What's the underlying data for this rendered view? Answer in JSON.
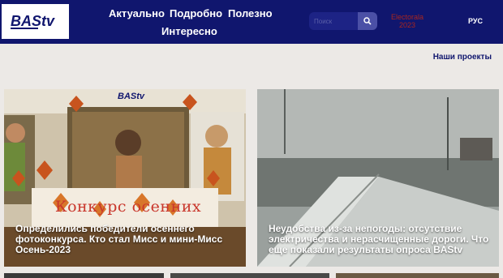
{
  "header": {
    "logo_text": "BAStv",
    "nav": [
      "Актуально",
      "Подробно",
      "Полезно",
      "Интересно"
    ],
    "search_placeholder": "Поиск",
    "electorala": "Electorala 2023",
    "language": "РУС"
  },
  "projects_link": "Наши проекты",
  "cards": [
    {
      "image_text": "Конкурс осенних",
      "title": "Определились победители осеннего фотоконкурса. Кто стал Мисс и мини-Мисс Осень-2023"
    },
    {
      "title": "Неудобства из-за непогоды: отсутствие электричества и нерасчищенные дороги. Что еще показали результаты опроса BAStv"
    }
  ],
  "colors": {
    "header_bg": "#10166e",
    "page_bg": "#ece9e6",
    "accent_red": "#a8251f",
    "search_button": "#4b50a6"
  },
  "icons": [
    "logo",
    "search-icon"
  ]
}
